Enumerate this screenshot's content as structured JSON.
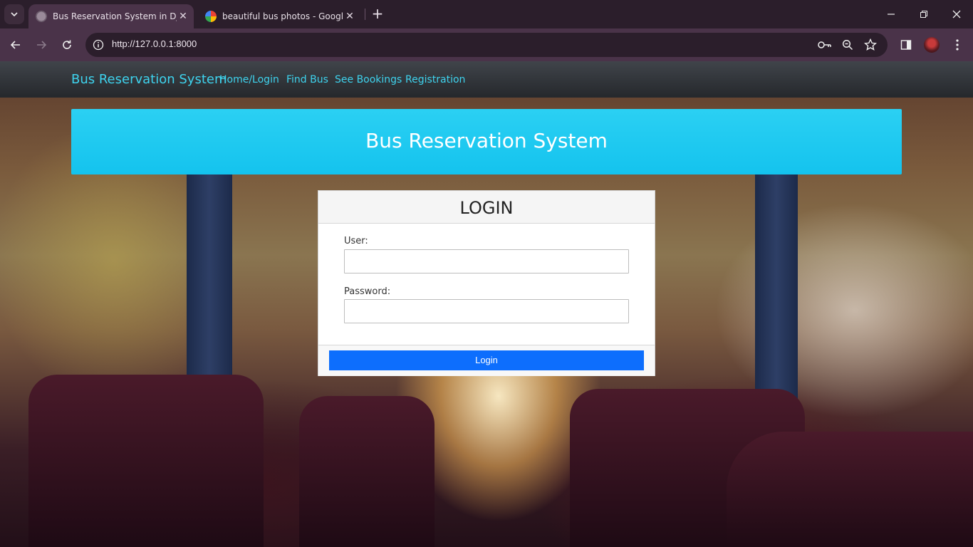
{
  "browser": {
    "tabs": [
      {
        "title": "Bus Reservation System in Djan",
        "active": true
      },
      {
        "title": "beautiful bus photos - Google S",
        "active": false
      }
    ],
    "url": "http://127.0.0.1:8000"
  },
  "navbar": {
    "brand": "Bus Reservation System",
    "links": [
      "Home/Login",
      "Find Bus",
      "See Bookings",
      "Registration"
    ]
  },
  "hero": {
    "title": "Bus Reservation System"
  },
  "login": {
    "title": "LOGIN",
    "user_label": "User:",
    "user_value": "",
    "password_label": "Password:",
    "password_value": "",
    "button": "Login"
  },
  "colors": {
    "accent": "#3ed3ee",
    "hero": "#14c3ee",
    "button": "#0d6efd",
    "chrome": "#4a3349"
  }
}
